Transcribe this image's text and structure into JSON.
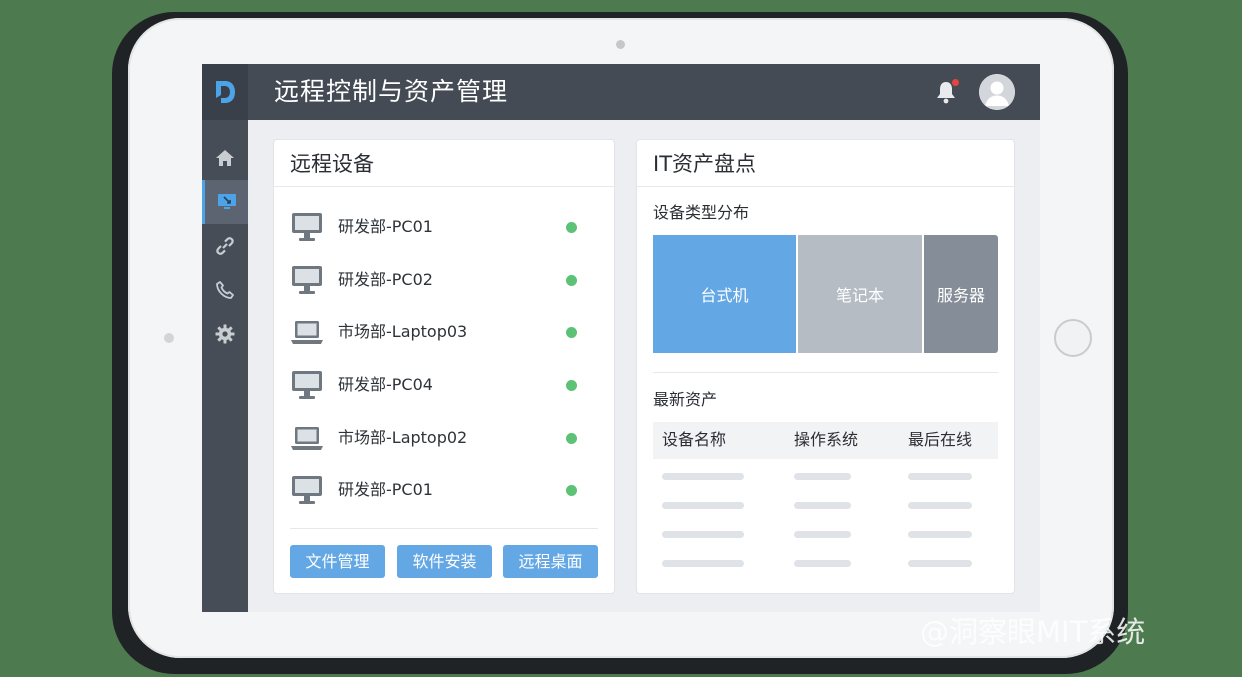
{
  "header": {
    "app_title": "远程控制与资产管理"
  },
  "icons": {
    "logo": "brand-logo-icon",
    "bell": "bell-icon",
    "avatar": "user-avatar-icon"
  },
  "sidebar": {
    "items": [
      {
        "icon": "home-icon",
        "active": false
      },
      {
        "icon": "monitor-remote-icon",
        "active": true
      },
      {
        "icon": "link-icon",
        "active": false
      },
      {
        "icon": "phone-icon",
        "active": false
      },
      {
        "icon": "gear-icon",
        "active": false
      }
    ]
  },
  "remote_devices": {
    "title": "远程设备",
    "devices": [
      {
        "name": "研发部-PC01",
        "type": "desktop",
        "status": "online"
      },
      {
        "name": "研发部-PC02",
        "type": "desktop",
        "status": "online"
      },
      {
        "name": "市场部-Laptop03",
        "type": "laptop",
        "status": "online"
      },
      {
        "name": "研发部-PC04",
        "type": "desktop",
        "status": "online"
      },
      {
        "name": "市场部-Laptop02",
        "type": "laptop",
        "status": "online"
      },
      {
        "name": "研发部-PC01",
        "type": "desktop",
        "status": "online"
      }
    ],
    "actions": [
      "文件管理",
      "软件安装",
      "远程桌面"
    ]
  },
  "it_assets": {
    "title": "IT资产盘点",
    "distribution_title": "设备类型分布",
    "distribution": [
      {
        "label": "台式机",
        "color": "#63a8e4"
      },
      {
        "label": "笔记本",
        "color": "#b5bcc4"
      },
      {
        "label": "服务器",
        "color": "#858d98"
      }
    ],
    "latest_title": "最新资产",
    "columns": [
      "设备名称",
      "操作系统",
      "最后在线"
    ]
  },
  "colors": {
    "online": "#5cc275",
    "accent": "#63a8e4",
    "header": "#444b54"
  },
  "watermark": "@洞察眼MIT系统"
}
